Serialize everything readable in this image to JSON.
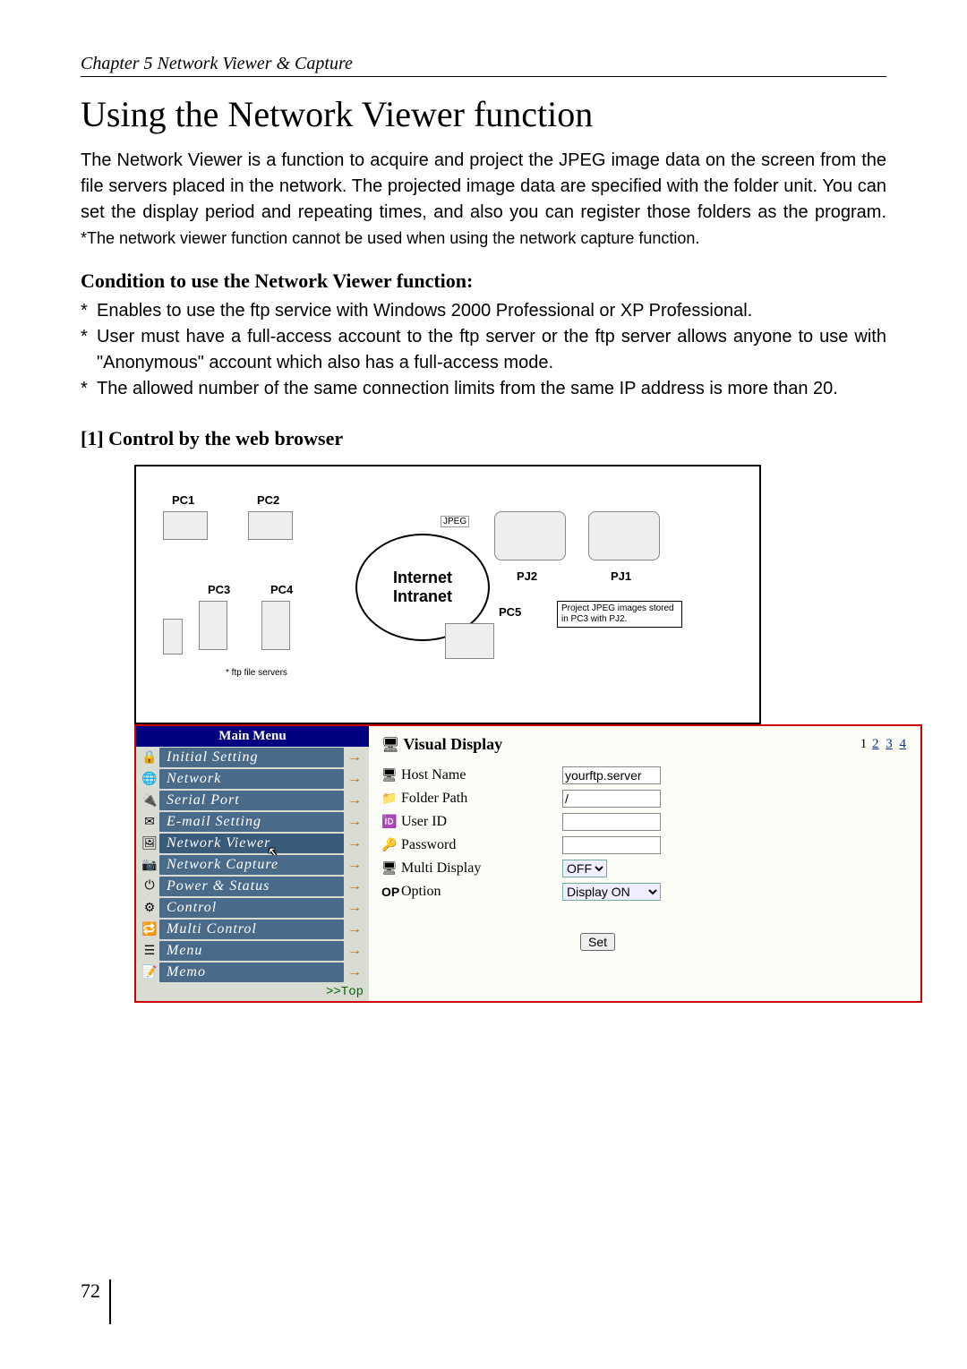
{
  "chapter": "Chapter 5 Network Viewer & Capture",
  "title": "Using the Network Viewer function",
  "intro": "The Network Viewer is a function to acquire and project the JPEG image data on the screen from the file servers placed in the network. The projected image data are specified with the folder unit. You can set the display period and repeating times, and also you can register those folders as the program. ",
  "intro_note": "*The network viewer function cannot be used when using the network capture function.",
  "condition_heading": "Condition to use the Network Viewer function:",
  "conditions": [
    "Enables to use the ftp service with Windows 2000 Professional or XP Professional.",
    "User must have a full-access account to the ftp server or the ftp server allows anyone to use with \"Anonymous\" account which also has a full-access mode.",
    "The allowed number of the same connection limits from the same IP address is more than 20."
  ],
  "subsection": "[1] Control by the web browser",
  "diagram": {
    "pc1": "PC1",
    "pc2": "PC2",
    "pc3": "PC3",
    "pc4": "PC4",
    "pc5": "PC5",
    "pj1": "PJ1",
    "pj2": "PJ2",
    "jpeg": "JPEG",
    "cloud": "Internet\nIntranet",
    "ftp_note": "* ftp file servers",
    "proj_note": "Project JPEG images stored in PC3 with PJ2."
  },
  "sidebar": {
    "header": "Main Menu",
    "items": [
      {
        "label": "Initial Setting"
      },
      {
        "label": "Network"
      },
      {
        "label": "Serial Port"
      },
      {
        "label": "E-mail Setting"
      },
      {
        "label": "Network Viewer",
        "selected": true
      },
      {
        "label": "Network Capture"
      },
      {
        "label": "Power & Status"
      },
      {
        "label": "Control"
      },
      {
        "label": "Multi Control"
      },
      {
        "label": "Menu"
      },
      {
        "label": "Memo"
      }
    ],
    "top": ">>Top"
  },
  "form": {
    "title": "Visual Display",
    "pager_current": "1",
    "pager_links": [
      "2",
      "3",
      "4"
    ],
    "host_label": "Host Name",
    "host_value": "yourftp.server",
    "folder_label": "Folder Path",
    "folder_value": "/",
    "user_label": "User ID",
    "user_value": "",
    "pass_label": "Password",
    "pass_value": "",
    "multi_label": "Multi Display",
    "multi_value": "OFF",
    "option_label": "Option",
    "option_value": "Display ON",
    "set": "Set"
  },
  "page_number": "72"
}
